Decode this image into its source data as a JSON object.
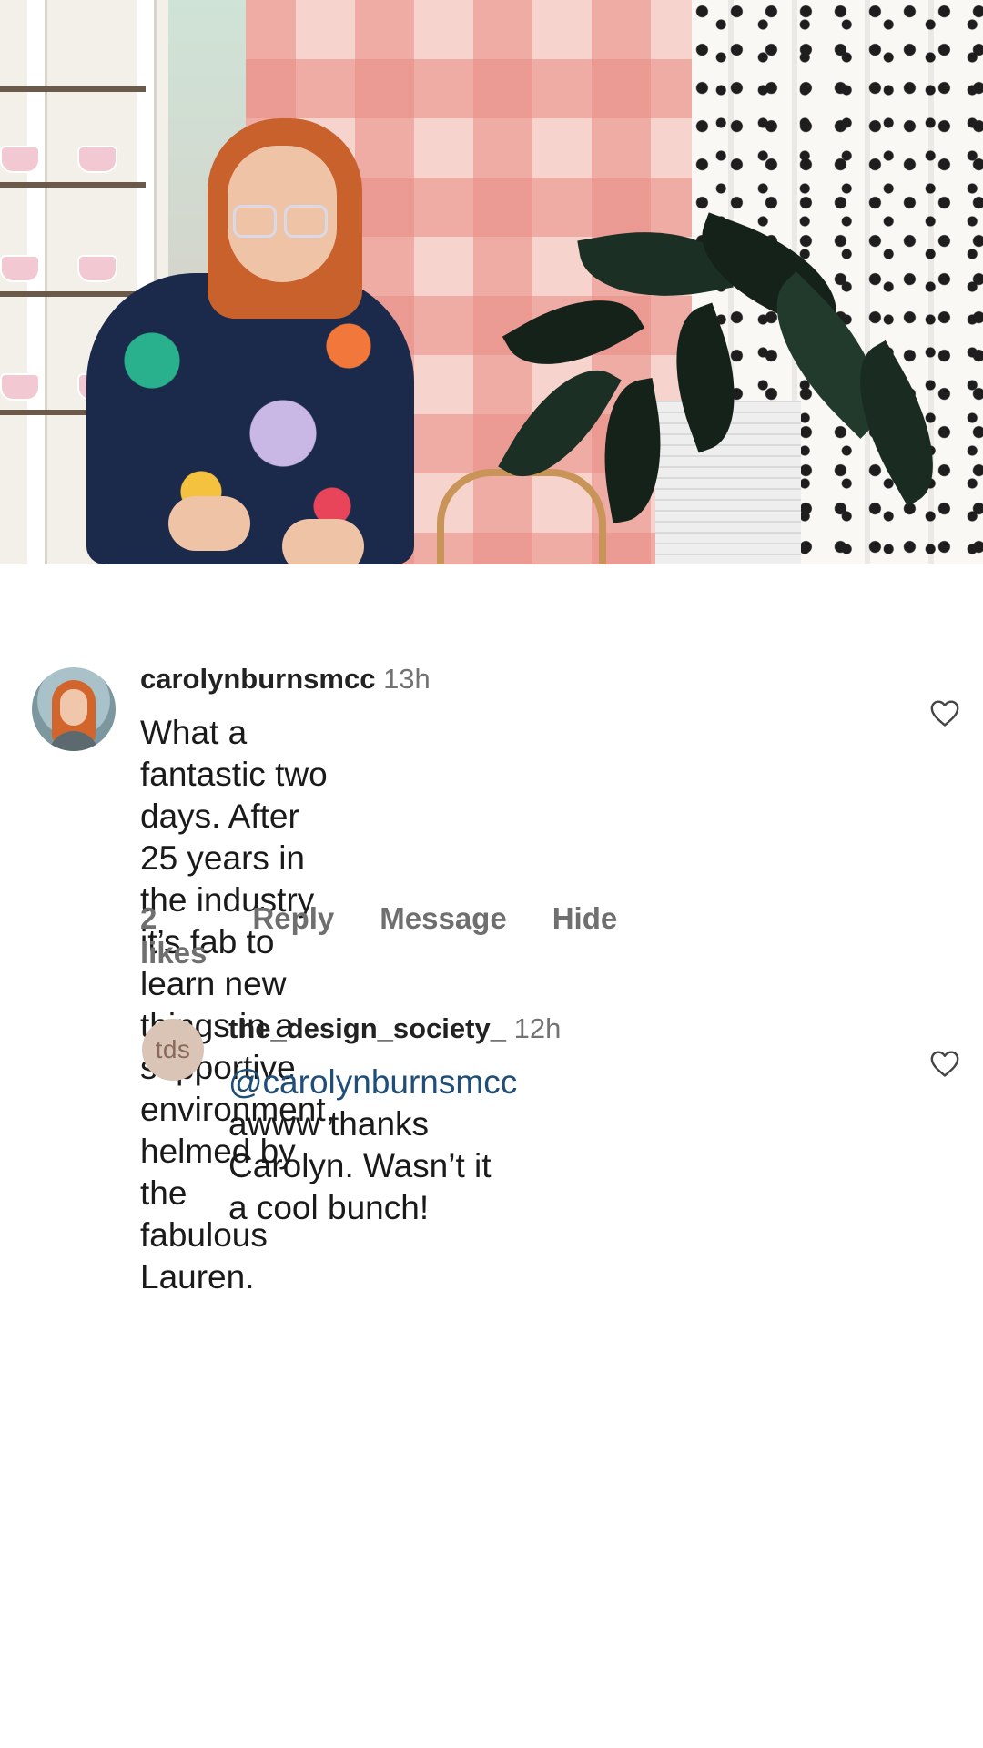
{
  "comments": [
    {
      "username": "carolynburnsmcc",
      "time": "13h",
      "text": "What a fantastic two days. After 25 years in the industry it’s fab to learn new things in a supportive environment, helmed by the fabulous Lauren.",
      "lines": [
        "What a fantastic two days. After 25 years in",
        "the industry it’s fab to learn new things in a",
        "supportive environment, helmed by the",
        "fabulous Lauren."
      ],
      "actions": {
        "likes": "2 likes",
        "reply": "Reply",
        "message": "Message",
        "hide": "Hide"
      }
    },
    {
      "username": "the_design_society_",
      "time": "12h",
      "avatar_text": "tds",
      "mention": "@carolynburnsmcc",
      "line1_rest": " awww thanks",
      "line2": "Carolyn. Wasn’t it a cool bunch!"
    }
  ],
  "icons": {
    "like_icon": "heart-outline"
  },
  "colors": {
    "mention": "#1f4e79",
    "secondary_text": "#737373"
  }
}
